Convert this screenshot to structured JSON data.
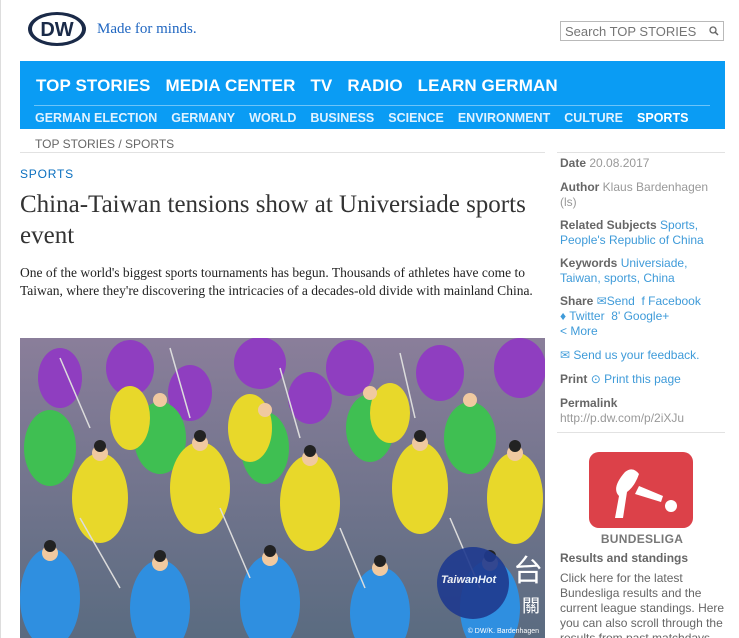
{
  "header": {
    "logo_text": "DW",
    "slogan": "Made for minds.",
    "search_placeholder": "Search TOP STORIES"
  },
  "nav": {
    "main": [
      "TOP STORIES",
      "MEDIA CENTER",
      "TV",
      "RADIO",
      "LEARN GERMAN"
    ],
    "sub": [
      "GERMAN ELECTION",
      "GERMANY",
      "WORLD",
      "BUSINESS",
      "SCIENCE",
      "ENVIRONMENT",
      "CULTURE",
      "SPORTS"
    ]
  },
  "breadcrumb": {
    "text": "TOP STORIES / SPORTS"
  },
  "article": {
    "kicker": "SPORTS",
    "title": "China-Taiwan tensions show at Universiade sports event",
    "teaser": "One of the world's biggest sports tournaments has begun. Thousands of athletes have come to Taiwan, where they're discovering the intricacies of a decades-old divide with mainland China.",
    "photo_credit": "© DW/K. Bardenhagen",
    "watermark_text": "TaiwanHot",
    "watermark_char1": "台",
    "watermark_char2": "關"
  },
  "sidebar": {
    "date_label": "Date",
    "date_value": "20.08.2017",
    "author_label": "Author",
    "author_value": "Klaus Bardenhagen (ls)",
    "subjects_label": "Related Subjects",
    "subjects_1": "Sports,",
    "subjects_2": "People's Republic of China",
    "keywords_label": "Keywords",
    "keywords_1": "Universiade,",
    "keywords_2": "Taiwan, sports, China",
    "share_label": "Share",
    "share_send": "Send",
    "share_facebook": "Facebook",
    "share_twitter": "Twitter",
    "share_google": "Google+",
    "share_more": "More",
    "feedback": "Send us your feedback.",
    "print_label": "Print",
    "print_link": "Print this page",
    "permalink_label": "Permalink",
    "permalink_value": "http://p.dw.com/p/2iXJu",
    "bundesliga_logo_text": "BUNDESLIGA",
    "bundesliga_title": "Results and standings",
    "bundesliga_desc": "Click here for the latest Bundesliga results and the current league standings. Here you can also scroll through the results from past matchdays and"
  },
  "colors": {
    "nav_blue": "#0a9cf4",
    "link_blue": "#3f9bd9",
    "logo_blue": "#1f66c1",
    "bundesliga_red": "#d6202a"
  }
}
